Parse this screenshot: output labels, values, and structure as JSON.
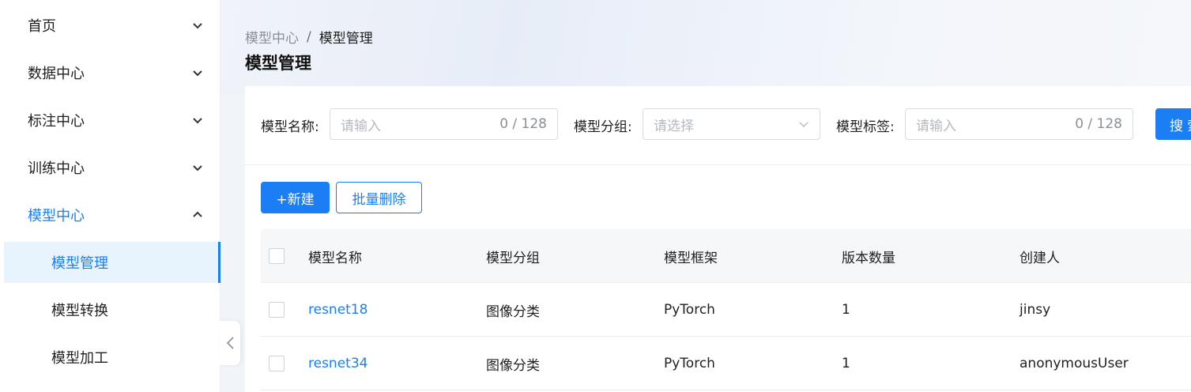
{
  "sidebar": {
    "items": [
      {
        "label": "首页"
      },
      {
        "label": "数据中心"
      },
      {
        "label": "标注中心"
      },
      {
        "label": "训练中心"
      },
      {
        "label": "模型中心"
      }
    ],
    "subitems": [
      {
        "label": "模型管理"
      },
      {
        "label": "模型转换"
      },
      {
        "label": "模型加工"
      }
    ]
  },
  "breadcrumb": {
    "parent": "模型中心",
    "separator": "/",
    "current": "模型管理"
  },
  "page_title": "模型管理",
  "filters": {
    "name_label": "模型名称:",
    "name_placeholder": "请输入",
    "name_counter": "0 / 128",
    "group_label": "模型分组:",
    "group_placeholder": "请选择",
    "tag_label": "模型标签:",
    "tag_placeholder": "请输入",
    "tag_counter": "0 / 128",
    "search_label": "搜 索"
  },
  "actions": {
    "create_label": "+新建",
    "batch_delete_label": "批量删除"
  },
  "table": {
    "headers": [
      "模型名称",
      "模型分组",
      "模型框架",
      "版本数量",
      "创建人"
    ],
    "rows": [
      [
        "resnet18",
        "图像分类",
        "PyTorch",
        "1",
        "jinsy"
      ],
      [
        "resnet34",
        "图像分类",
        "PyTorch",
        "1",
        "anonymousUser"
      ]
    ]
  },
  "colors": {
    "accent": "#1c7ef5",
    "selected_bg": "#e8f4fd"
  }
}
